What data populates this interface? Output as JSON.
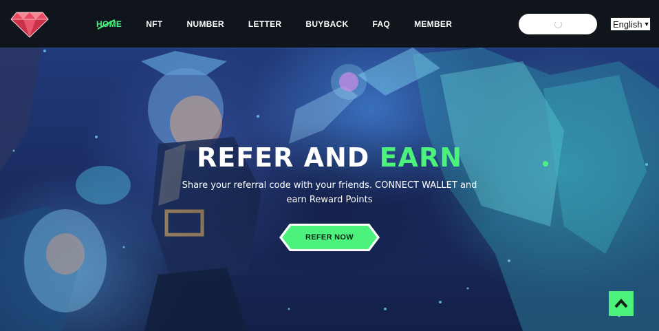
{
  "nav": {
    "items": [
      {
        "label": "HOME",
        "active": true
      },
      {
        "label": "NFT",
        "active": false
      },
      {
        "label": "NUMBER",
        "active": false
      },
      {
        "label": "LETTER",
        "active": false
      },
      {
        "label": "BUYBACK",
        "active": false
      },
      {
        "label": "FAQ",
        "active": false
      },
      {
        "label": "MEMBER",
        "active": false
      }
    ]
  },
  "header": {
    "wallet_button_state": "loading",
    "language": "English"
  },
  "hero": {
    "title_main": "REFER AND ",
    "title_accent": "EARN",
    "subtitle": "Share your referral code with your friends. CONNECT WALLET and earn Reward Points",
    "cta_label": "REFER NOW"
  },
  "colors": {
    "accent": "#4cf27c",
    "header_bg": "#0f151b",
    "logo": "#e84a5f"
  },
  "icons": {
    "logo": "diamond-icon",
    "scroll_top": "chevron-up-icon",
    "loading": "spinner-icon"
  }
}
